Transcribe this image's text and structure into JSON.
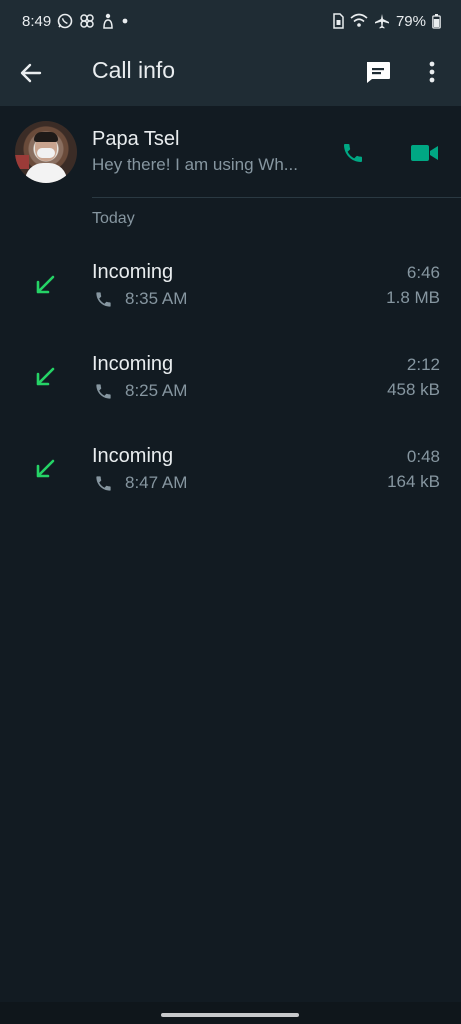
{
  "status_bar": {
    "time": "8:49",
    "battery": "79%",
    "left_icons": [
      "whatsapp-icon",
      "pinwheel-icon",
      "figure-icon",
      "dot-icon"
    ],
    "right_icons": [
      "sim-icon",
      "wifi-icon",
      "airplane-icon",
      "battery-icon"
    ]
  },
  "app_bar": {
    "title": "Call info",
    "back_icon": "arrow-left-icon",
    "message_icon": "message-icon",
    "more_icon": "more-vertical-icon"
  },
  "contact": {
    "name": "Papa Tsel",
    "status": "Hey there! I am using Wh...",
    "voice_icon": "phone-icon",
    "video_icon": "video-icon"
  },
  "section": {
    "label": "Today"
  },
  "calls": [
    {
      "type": "Incoming",
      "time": "8:35 AM",
      "duration": "6:46",
      "size": "1.8 MB"
    },
    {
      "type": "Incoming",
      "time": "8:25 AM",
      "duration": "2:12",
      "size": "458 kB"
    },
    {
      "type": "Incoming",
      "time": "8:47 AM",
      "duration": "0:48",
      "size": "164 kB"
    }
  ],
  "colors": {
    "background": "#121b22",
    "header": "#1f2c34",
    "accent": "#00a884",
    "incoming_arrow": "#25d366",
    "primary_text": "#e9edef",
    "secondary_text": "#8696a0"
  }
}
